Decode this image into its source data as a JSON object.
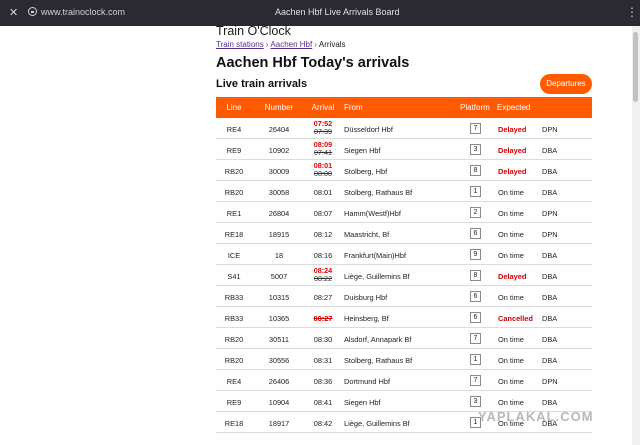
{
  "browser": {
    "close_icon": "close-icon",
    "url": "www.trainoclock.com",
    "window_title": "Aachen Hbf Live Arrivals Board",
    "menu_icon": "kebab-menu-icon"
  },
  "site": {
    "name": "Train O'Clock"
  },
  "breadcrumb": [
    {
      "label": "Train stations",
      "link": true
    },
    {
      "label": "Aachen Hbf",
      "link": true
    },
    {
      "label": "Arrivals",
      "link": false
    }
  ],
  "breadcrumb_sep": "›",
  "page": {
    "title": "Aachen Hbf Today's arrivals",
    "subtitle": "Live train arrivals",
    "departures_button": "Departures"
  },
  "colors": {
    "accent": "#ff5a00",
    "delayed": "#d40000"
  },
  "table": {
    "headers": [
      "Line",
      "Number",
      "Arrival",
      "From",
      "Platform",
      "Expected"
    ],
    "rows": [
      {
        "line": "RE4",
        "number": "26404",
        "arrival": "07:52",
        "scheduled": "07:39",
        "from": "Düsseldorf Hbf",
        "platform": "7",
        "expected": "Delayed",
        "operator": "DPN"
      },
      {
        "line": "RE9",
        "number": "10902",
        "arrival": "08:09",
        "scheduled": "07:41",
        "from": "Siegen Hbf",
        "platform": "3",
        "expected": "Delayed",
        "operator": "DBA"
      },
      {
        "line": "RB20",
        "number": "30009",
        "arrival": "08:01",
        "scheduled": "08:00",
        "from": "Stolberg, Hbf",
        "platform": "8",
        "expected": "Delayed",
        "operator": "DBA"
      },
      {
        "line": "RB20",
        "number": "30058",
        "arrival": "08:01",
        "scheduled": "",
        "from": "Stolberg, Rathaus Bf",
        "platform": "1",
        "expected": "On time",
        "operator": "DBA"
      },
      {
        "line": "RE1",
        "number": "26804",
        "arrival": "08:07",
        "scheduled": "",
        "from": "Hamm(Westf)Hbf",
        "platform": "2",
        "expected": "On time",
        "operator": "DPN"
      },
      {
        "line": "RE18",
        "number": "18915",
        "arrival": "08:12",
        "scheduled": "",
        "from": "Maastricht, Bf",
        "platform": "6",
        "expected": "On time",
        "operator": "DPN"
      },
      {
        "line": "ICE",
        "number": "18",
        "arrival": "08:16",
        "scheduled": "",
        "from": "Frankfurt(Main)Hbf",
        "platform": "9",
        "expected": "On time",
        "operator": "DBA"
      },
      {
        "line": "S41",
        "number": "5007",
        "arrival": "08:24",
        "scheduled": "08:22",
        "from": "Liège, Guillemins Bf",
        "platform": "8",
        "expected": "Delayed",
        "operator": "DBA"
      },
      {
        "line": "RB33",
        "number": "10315",
        "arrival": "08:27",
        "scheduled": "",
        "from": "Duisburg Hbf",
        "platform": "6",
        "expected": "On time",
        "operator": "DBA"
      },
      {
        "line": "RB33",
        "number": "10365",
        "arrival": "08:27",
        "scheduled": "",
        "cancelled": true,
        "from": "Heinsberg, Bf",
        "platform": "6",
        "expected": "Cancelled",
        "operator": "DBA"
      },
      {
        "line": "RB20",
        "number": "30511",
        "arrival": "08:30",
        "scheduled": "",
        "from": "Alsdorf, Annapark Bf",
        "platform": "7",
        "expected": "On time",
        "operator": "DBA"
      },
      {
        "line": "RB20",
        "number": "30556",
        "arrival": "08:31",
        "scheduled": "",
        "from": "Stolberg, Rathaus Bf",
        "platform": "1",
        "expected": "On time",
        "operator": "DBA"
      },
      {
        "line": "RE4",
        "number": "26406",
        "arrival": "08:36",
        "scheduled": "",
        "from": "Dortmund Hbf",
        "platform": "7",
        "expected": "On time",
        "operator": "DPN"
      },
      {
        "line": "RE9",
        "number": "10904",
        "arrival": "08:41",
        "scheduled": "",
        "from": "Siegen Hbf",
        "platform": "3",
        "expected": "On time",
        "operator": "DBA"
      },
      {
        "line": "RE18",
        "number": "18917",
        "arrival": "08:42",
        "scheduled": "",
        "from": "Liège, Guillemins Bf",
        "platform": "1",
        "expected": "On time",
        "operator": "DBA"
      }
    ]
  },
  "watermark": "YAPLAKAL.COM"
}
